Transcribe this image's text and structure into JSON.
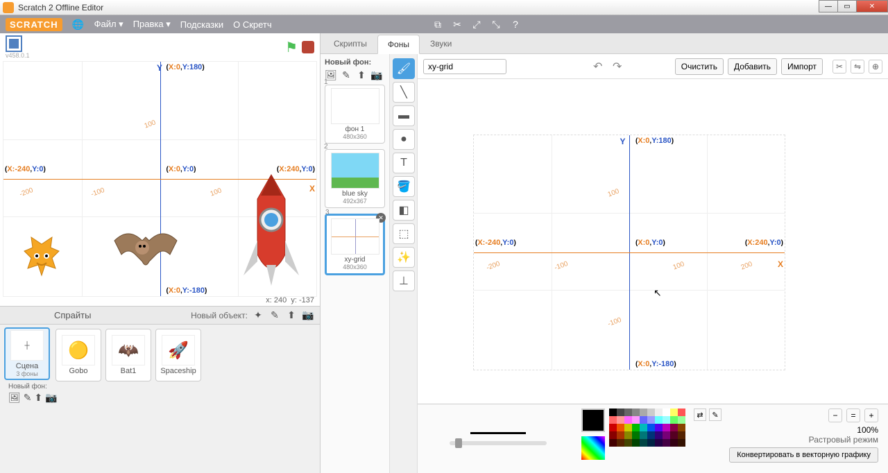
{
  "window": {
    "title": "Scratch 2 Offline Editor"
  },
  "menubar": {
    "logo": "SCRATCH",
    "items": [
      "Файл ▾",
      "Правка ▾",
      "Подсказки",
      "О Скретч"
    ]
  },
  "stage": {
    "version": "v458.0.1",
    "coords": {
      "top": "(X:0,Y:180)",
      "left": "(X:-240,Y:0)",
      "center": "(X:0,Y:0)",
      "right": "(X:240,Y:0)",
      "bottom": "(X:0,Y:-180)"
    },
    "ticks": [
      "-200",
      "-100",
      "100",
      "200"
    ],
    "axis_x": "X",
    "axis_y": "Y",
    "readout_x_lbl": "x:",
    "readout_x": "240",
    "readout_y_lbl": "y:",
    "readout_y": "-137"
  },
  "sprites_panel": {
    "label": "Спрайты",
    "new_label": "Новый объект:",
    "stage_name": "Сцена",
    "stage_sub": "3 фоны",
    "items": [
      {
        "name": "Gobo"
      },
      {
        "name": "Bat1"
      },
      {
        "name": "Spaceship"
      }
    ],
    "newbg_label": "Новый фон:"
  },
  "tabs": {
    "scripts": "Скрипты",
    "costumes": "Фоны",
    "sounds": "Звуки"
  },
  "bg_list": {
    "title": "Новый фон:",
    "items": [
      {
        "num": "1",
        "name": "фон 1",
        "size": "480x360"
      },
      {
        "num": "2",
        "name": "blue sky",
        "size": "492x367"
      },
      {
        "num": "3",
        "name": "xy-grid",
        "size": "480x360"
      }
    ]
  },
  "toolbar": {
    "name": "xy-grid",
    "clear": "Очистить",
    "add": "Добавить",
    "import": "Импорт"
  },
  "bottom": {
    "zoom": "100%",
    "mode": "Растровый режим",
    "convert": "Конвертировать в векторную графику"
  },
  "palette_rows": [
    [
      "#000",
      "#444",
      "#666",
      "#888",
      "#aaa",
      "#ccc",
      "#eee",
      "#fff",
      "#ff6",
      "#f55"
    ],
    [
      "#f66",
      "#f99",
      "#f6f",
      "#f9f",
      "#66f",
      "#99f",
      "#6ff",
      "#9ff",
      "#6f6",
      "#9f9"
    ],
    [
      "#c00",
      "#e50",
      "#cc0",
      "#0b0",
      "#0bb",
      "#05e",
      "#50e",
      "#b0b",
      "#804",
      "#840"
    ],
    [
      "#800",
      "#a30",
      "#880",
      "#070",
      "#077",
      "#037",
      "#307",
      "#707",
      "#502",
      "#520"
    ],
    [
      "#400",
      "#520",
      "#440",
      "#040",
      "#044",
      "#024",
      "#204",
      "#404",
      "#301",
      "#310"
    ]
  ]
}
